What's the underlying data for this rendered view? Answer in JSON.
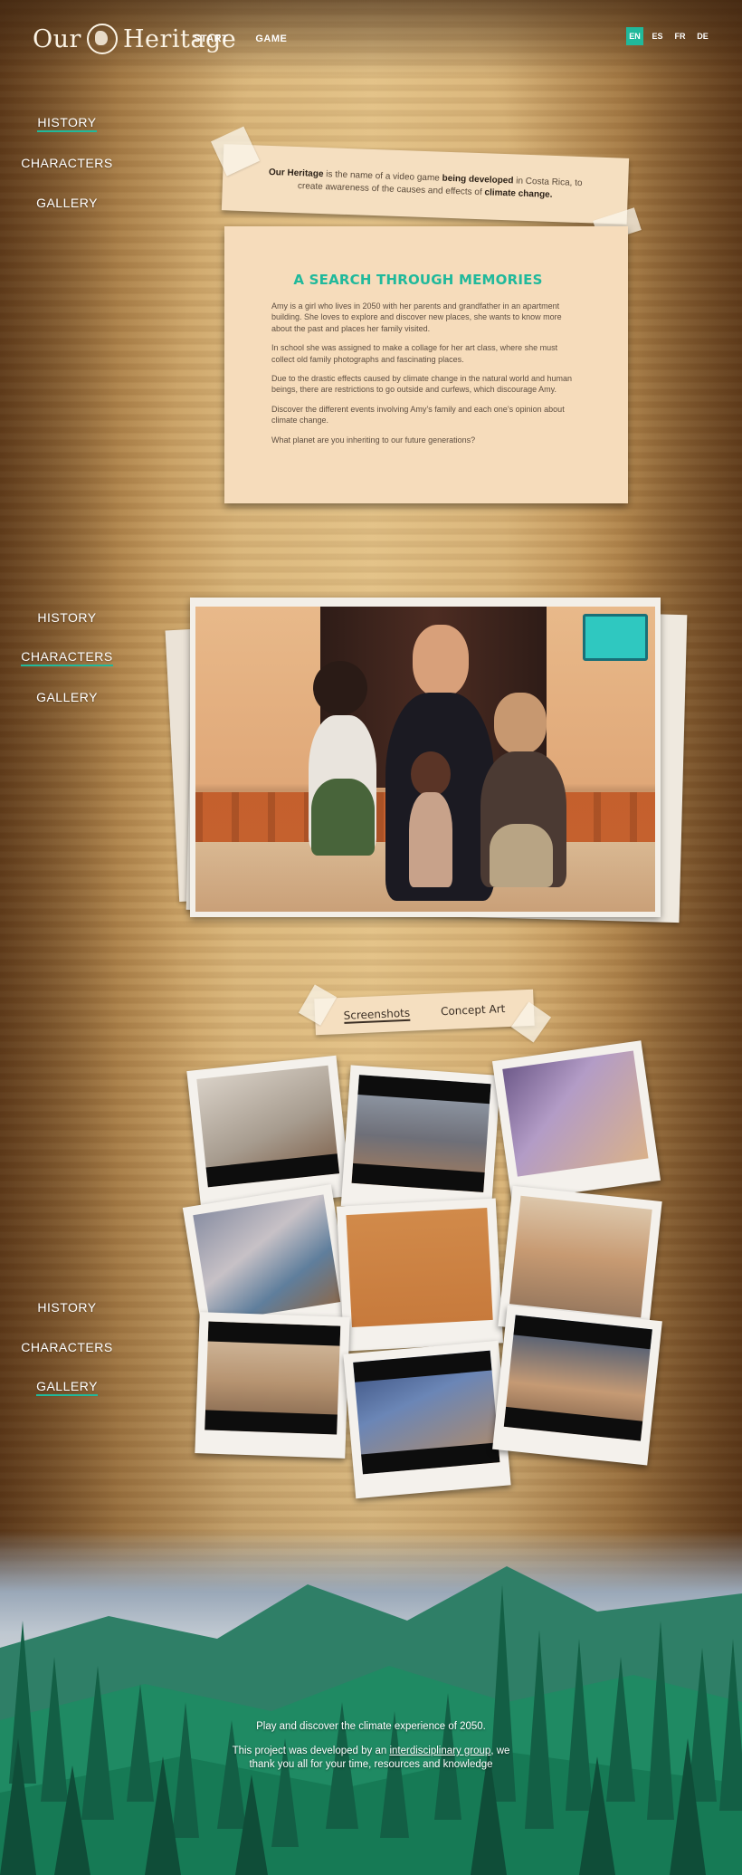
{
  "header": {
    "logo_left": "Our",
    "logo_right": "Heritage",
    "nav": [
      "START",
      "GAME"
    ],
    "languages": [
      "EN",
      "ES",
      "FR",
      "DE"
    ],
    "active_language": "EN",
    "accent_color": "#20b99b"
  },
  "sidenav": {
    "items": [
      "HISTORY",
      "CHARACTERS",
      "GALLERY"
    ]
  },
  "intro": {
    "brand": "Our Heritage",
    "text_1": " is the name of a video game ",
    "strong_1": "being developed",
    "text_2": " in Costa Rica, to create awareness of the causes and effects of ",
    "strong_2": "climate change."
  },
  "story": {
    "title": "A SEARCH THROUGH MEMORIES",
    "paragraphs": [
      "Amy is a girl who lives in 2050 with her parents and grandfather in an apartment building. She loves to explore and discover new places, she wants to know more about the past and places her family visited.",
      "In school she was assigned to make a collage for her art class, where she must collect old family photographs and fascinating places.",
      "Due to the drastic effects caused by climate change in the natural world and human beings, there are restrictions to go outside and curfews, which discourage Amy.",
      "Discover the different events involving Amy’s family and each one’s opinion about climate change.",
      "What planet are you inheriting to our future generations?"
    ]
  },
  "gallery": {
    "tabs": [
      "Screenshots",
      "Concept Art"
    ],
    "active_tab": "Screenshots"
  },
  "footer": {
    "line1": "Play and discover the climate experience of 2050.",
    "line2a": "This project was developed by an ",
    "line2_link": "interdisciplinary group",
    "line2b": ", we",
    "line3": "thank you all for your time, resources and knowledge"
  }
}
